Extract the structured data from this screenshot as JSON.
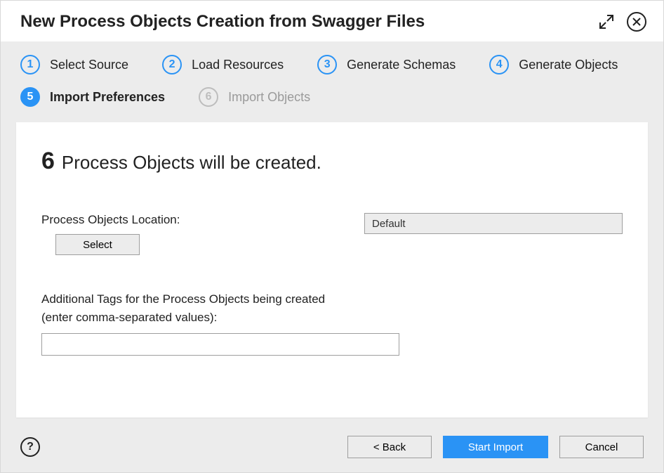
{
  "dialog": {
    "title": "New Process Objects Creation from Swagger Files"
  },
  "steps": [
    {
      "num": "1",
      "label": "Select Source",
      "state": "done"
    },
    {
      "num": "2",
      "label": "Load Resources",
      "state": "done"
    },
    {
      "num": "3",
      "label": "Generate Schemas",
      "state": "done"
    },
    {
      "num": "4",
      "label": "Generate Objects",
      "state": "done"
    },
    {
      "num": "5",
      "label": "Import Preferences",
      "state": "current"
    },
    {
      "num": "6",
      "label": "Import Objects",
      "state": "future"
    }
  ],
  "summary": {
    "count": "6",
    "text": "Process Objects will be created."
  },
  "location": {
    "label": "Process Objects Location:",
    "select_button": "Select",
    "value": "Default"
  },
  "tags": {
    "label_line1": "Additional Tags for the Process Objects being created",
    "label_line2": "(enter comma-separated values):",
    "value": ""
  },
  "footer": {
    "help_tooltip": "?",
    "back": "< Back",
    "start": "Start Import",
    "cancel": "Cancel"
  }
}
